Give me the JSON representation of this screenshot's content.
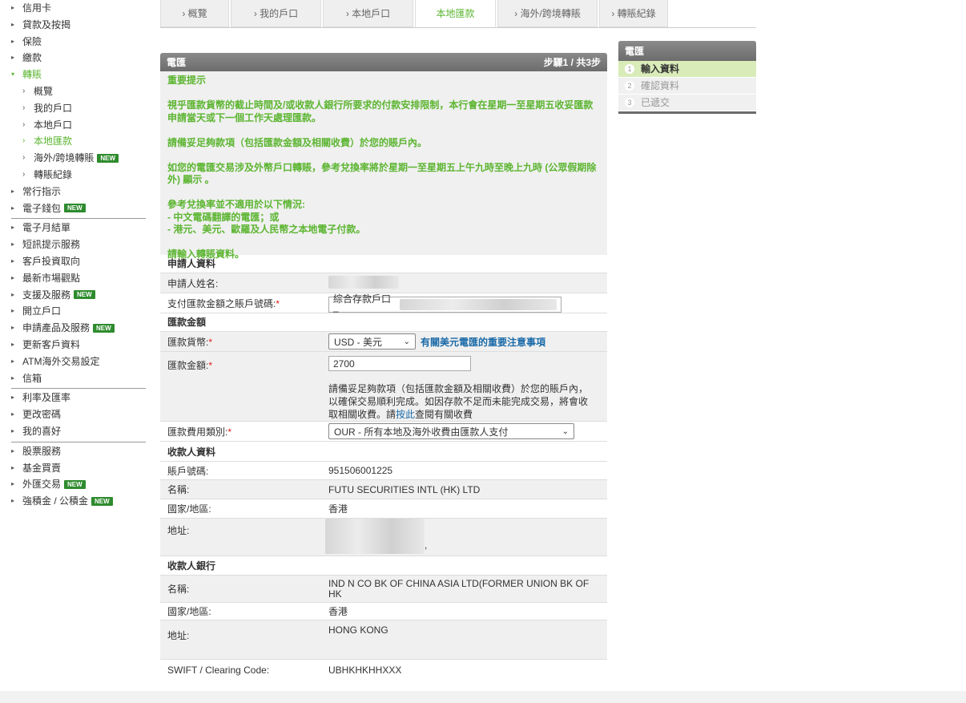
{
  "sidebar": {
    "group1": [
      {
        "label": "信用卡"
      },
      {
        "label": "貸款及按揭"
      },
      {
        "label": "保險"
      },
      {
        "label": "繳款"
      }
    ],
    "transfer": {
      "label": "轉賬"
    },
    "transfer_sub": [
      {
        "label": "概覽"
      },
      {
        "label": "我的戶口"
      },
      {
        "label": "本地戶口"
      },
      {
        "label": "本地匯款"
      },
      {
        "label": "海外/跨境轉賬",
        "badge": "NEW"
      },
      {
        "label": "轉賬紀錄"
      }
    ],
    "group1b": [
      {
        "label": "常行指示"
      },
      {
        "label": "電子錢包",
        "badge": "NEW"
      }
    ],
    "group2": [
      {
        "label": "電子月結單"
      },
      {
        "label": "短訊提示服務"
      },
      {
        "label": "客戶投資取向"
      },
      {
        "label": "最新市場觀點"
      },
      {
        "label": "支援及服務",
        "badge": "NEW"
      },
      {
        "label": "開立戶口"
      },
      {
        "label": "申請產品及服務",
        "badge": "NEW"
      },
      {
        "label": "更新客戶資料"
      },
      {
        "label": "ATM海外交易設定"
      },
      {
        "label": "信箱"
      }
    ],
    "group3": [
      {
        "label": "利率及匯率"
      },
      {
        "label": "更改密碼"
      },
      {
        "label": "我的喜好"
      }
    ],
    "group4": [
      {
        "label": "股票服務"
      },
      {
        "label": "基金買賣"
      },
      {
        "label": "外匯交易",
        "badge": "NEW"
      },
      {
        "label": "強積金 / 公積金",
        "badge": "NEW"
      }
    ]
  },
  "tabs": [
    {
      "label": "概覽"
    },
    {
      "label": "我的戶口"
    },
    {
      "label": "本地戶口"
    },
    {
      "label": "本地匯款"
    },
    {
      "label": "海外/跨境轉賬"
    },
    {
      "label": "轉賬紀錄"
    }
  ],
  "steps": {
    "title": "電匯",
    "items": [
      {
        "num": "1",
        "label": "輸入資料"
      },
      {
        "num": "2",
        "label": "確認資料"
      },
      {
        "num": "3",
        "label": "已遞交"
      }
    ]
  },
  "form": {
    "title": "電匯",
    "step_text": "步驟1 / 共3步",
    "notice": {
      "heading": "重要提示",
      "p1": "視乎匯款貨幣的截止時間及/或收款人銀行所要求的付款安排限制，本行會在星期一至星期五收妥匯款申請當天或下一個工作天處理匯款。",
      "p2": "請備妥足夠款項（包括匯款金額及相關收費）於您的賬戶內。",
      "p3": "如您的電匯交易涉及外幣戶口轉賬，參考兌換率將於星期一至星期五上午九時至晚上九時 (公眾假期除外) 顯示 。",
      "p4_title": "參考兌換率並不適用於以下情況:",
      "p4_l1": "- 中文電碼翻譯的電匯；或",
      "p4_l2": "- 港元、美元、歐羅及人民幣之本地電子付款。",
      "p5": "請輸入轉賬資料。"
    },
    "applicant": {
      "section": "申請人資料",
      "name_label": "申請人姓名:",
      "account_label": "支付匯款金額之賬戶號碼:",
      "account_value": "綜合存款戶口 –"
    },
    "amount": {
      "section": "匯款金額",
      "currency_label": "匯款貨幣:",
      "currency_value": "USD - 美元",
      "currency_link": "有關美元電匯的重要注意事項",
      "amount_label": "匯款金額:",
      "amount_value": "2700",
      "hint_a": "請備妥足夠款項（包括匯款金額及相關收費）於您的賬戶內，以確保交易順利完成。如因存款不足而未能完成交易，將會收取相關收費。請",
      "hint_link": "按此",
      "hint_b": "查閱有關收費",
      "fee_label": "匯款費用類別:",
      "fee_value": "OUR - 所有本地及海外收費由匯款人支付"
    },
    "payee": {
      "section": "收款人資料",
      "account_label": "賬戶號碼:",
      "account_value": "951506001225",
      "name_label": "名稱:",
      "name_value": "FUTU SECURITIES INTL (HK) LTD",
      "country_label": "國家/地區:",
      "country_value": "香港",
      "address_label": "地址:",
      "address_suffix": ","
    },
    "payee_bank": {
      "section": "收款人銀行",
      "name_label": "名稱:",
      "name_value": "IND N CO BK OF CHINA ASIA LTD(FORMER UNION BK OF HK",
      "country_label": "國家/地區:",
      "country_value": "香港",
      "address_label": "地址:",
      "address_value": "HONG KONG",
      "swift_label": "SWIFT / Clearing Code:",
      "swift_value": "UBHKHKHHXXX"
    },
    "required_mark": "*"
  },
  "colors": {
    "accent_green": "#5cb531",
    "header_gray": "#7a7a7a",
    "link_blue": "#1a6aa8",
    "required_red": "#e02020",
    "badge_green": "#2e8b2e"
  }
}
